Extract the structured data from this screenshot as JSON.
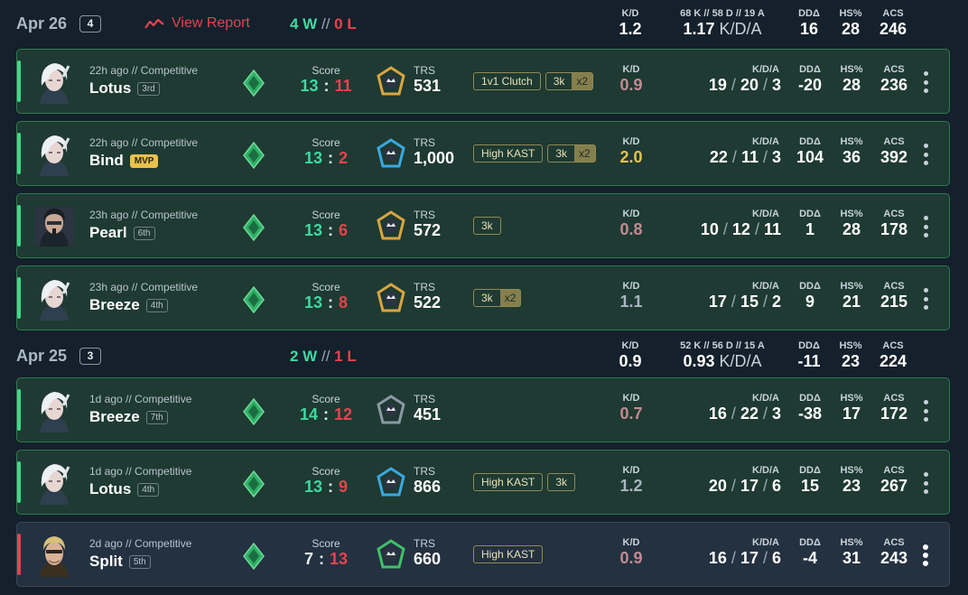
{
  "days": [
    {
      "date": "Apr 26",
      "count": "4",
      "view_report": "View Report",
      "wins": "4 W",
      "sep": "//",
      "losses": "0 L",
      "stats": {
        "kd_label": "K/D",
        "kd": "1.2",
        "kda_label": "68 K // 58 D // 19 A",
        "kda_ratio": "1.17",
        "kda_suffix": "K/D/A",
        "dd_label": "DDΔ",
        "dd": "16",
        "hs_label": "HS%",
        "hs": "28",
        "acs_label": "ACS",
        "acs": "246"
      }
    },
    {
      "date": "Apr 25",
      "count": "3",
      "wins": "2 W",
      "sep": "//",
      "losses": "1 L",
      "stats": {
        "kd_label": "K/D",
        "kd": "0.9",
        "kda_label": "52 K // 56 D // 15 A",
        "kda_ratio": "0.93",
        "kda_suffix": "K/D/A",
        "dd_label": "DDΔ",
        "dd": "-11",
        "hs_label": "HS%",
        "hs": "23",
        "acs_label": "ACS",
        "acs": "224"
      }
    }
  ],
  "labels": {
    "score": "Score",
    "trs": "TRS",
    "kd": "K/D",
    "kda": "K/D/A",
    "dd": "DDΔ",
    "hs": "HS%",
    "acs": "ACS",
    "colon": ":",
    "slash": "/"
  },
  "matches": [
    {
      "when": "22h ago // Competitive",
      "map": "Lotus",
      "place": "3rd",
      "mvp": "",
      "score_a": "13",
      "score_b": "11",
      "trs": "531",
      "tags": [
        {
          "t": "1v1 Clutch"
        },
        {
          "t": "3k",
          "x": "x2"
        }
      ],
      "kd": "0.9",
      "kd_tone": "bad",
      "k": "19",
      "d": "20",
      "a": "3",
      "dd": "-20",
      "hs": "28",
      "acs": "236",
      "result": "win",
      "agent": "white",
      "trs_color": "#d9a540"
    },
    {
      "when": "22h ago // Competitive",
      "map": "Bind",
      "place": "",
      "mvp": "MVP",
      "score_a": "13",
      "score_b": "2",
      "trs": "1,000",
      "tags": [
        {
          "t": "High KAST"
        },
        {
          "t": "3k",
          "x": "x2"
        }
      ],
      "kd": "2.0",
      "kd_tone": "good",
      "k": "22",
      "d": "11",
      "a": "3",
      "dd": "104",
      "hs": "36",
      "acs": "392",
      "result": "win",
      "agent": "white",
      "trs_color": "#3aa8e0"
    },
    {
      "when": "23h ago // Competitive",
      "map": "Pearl",
      "place": "6th",
      "mvp": "",
      "score_a": "13",
      "score_b": "6",
      "trs": "572",
      "tags": [
        {
          "t": "3k"
        }
      ],
      "kd": "0.8",
      "kd_tone": "bad",
      "k": "10",
      "d": "12",
      "a": "11",
      "dd": "1",
      "hs": "28",
      "acs": "178",
      "result": "win",
      "agent": "dark",
      "trs_color": "#d9a540"
    },
    {
      "when": "23h ago // Competitive",
      "map": "Breeze",
      "place": "4th",
      "mvp": "",
      "score_a": "13",
      "score_b": "8",
      "trs": "522",
      "tags": [
        {
          "t": "3k",
          "x": "x2"
        }
      ],
      "kd": "1.1",
      "kd_tone": "mid",
      "k": "17",
      "d": "15",
      "a": "2",
      "dd": "9",
      "hs": "21",
      "acs": "215",
      "result": "win",
      "agent": "white",
      "trs_color": "#d9a540"
    },
    {
      "when": "1d ago // Competitive",
      "map": "Breeze",
      "place": "7th",
      "mvp": "",
      "score_a": "14",
      "score_b": "12",
      "trs": "451",
      "tags": [],
      "kd": "0.7",
      "kd_tone": "bad",
      "k": "16",
      "d": "22",
      "a": "3",
      "dd": "-38",
      "hs": "17",
      "acs": "172",
      "result": "win",
      "agent": "white",
      "trs_color": "#8a9aa4"
    },
    {
      "when": "1d ago // Competitive",
      "map": "Lotus",
      "place": "4th",
      "mvp": "",
      "score_a": "13",
      "score_b": "9",
      "trs": "866",
      "tags": [
        {
          "t": "High KAST"
        },
        {
          "t": "3k"
        }
      ],
      "kd": "1.2",
      "kd_tone": "mid",
      "k": "20",
      "d": "17",
      "a": "6",
      "dd": "15",
      "hs": "23",
      "acs": "267",
      "result": "win",
      "agent": "white",
      "trs_color": "#3aa8e0"
    },
    {
      "when": "2d ago // Competitive",
      "map": "Split",
      "place": "5th",
      "mvp": "",
      "score_a": "7",
      "score_b": "13",
      "trs": "660",
      "tags": [
        {
          "t": "High KAST"
        }
      ],
      "kd": "0.9",
      "kd_tone": "bad",
      "k": "16",
      "d": "17",
      "a": "6",
      "dd": "-4",
      "hs": "31",
      "acs": "243",
      "result": "loss",
      "agent": "blond",
      "trs_color": "#3fc06a"
    }
  ]
}
